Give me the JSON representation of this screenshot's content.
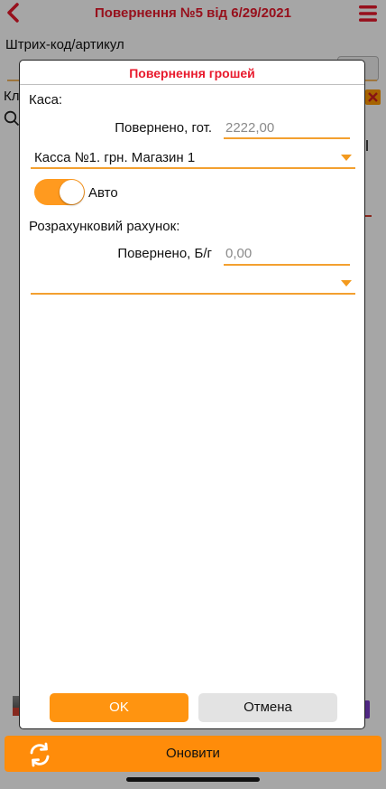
{
  "header": {
    "title": "Повернення №5 від 6/29/2021"
  },
  "barcode": {
    "label": "Штрих-код/артикул"
  },
  "background": {
    "client_label_fragment": "Кл"
  },
  "dialog": {
    "title": "Повернення грошей",
    "cash": {
      "section_label": "Каса:",
      "returned_label": "Повернено, гот.",
      "returned_value": "2222,00",
      "register_select": "Касса №1. грн. Магазин 1",
      "auto_toggle_on": true,
      "auto_label": "Авто"
    },
    "account": {
      "section_label": "Розрахунковий рахунок:",
      "returned_label": "Повернено, Б/г",
      "returned_value": "0,00",
      "account_select": ""
    },
    "ok_label": "OK",
    "cancel_label": "Отмена"
  },
  "footer": {
    "refresh_label": "Оновити"
  },
  "colors": {
    "accent": "#ff8c0a",
    "title_red": "#e8192c",
    "field_line": "#f3a030"
  }
}
